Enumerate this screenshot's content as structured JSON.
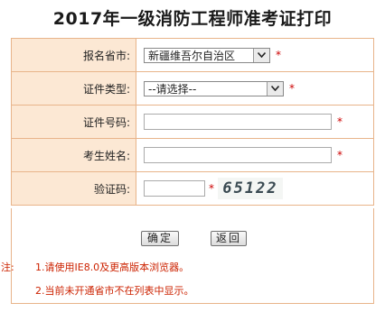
{
  "title": "2017年一级消防工程师准考证打印",
  "form": {
    "province_label": "报名省市:",
    "province_value": "新疆维吾尔自治区",
    "id_type_label": "证件类型:",
    "id_type_value": "--请选择--",
    "id_number_label": "证件号码:",
    "id_number_value": "",
    "name_label": "考生姓名:",
    "name_value": "",
    "captcha_label": "验证码:",
    "captcha_value": "",
    "captcha_text": "65122",
    "required_mark": "*"
  },
  "buttons": {
    "confirm": "确定",
    "back": "返回"
  },
  "notes": {
    "prefix": "注:",
    "line1": "1.请使用IE8.0及更高版本浏览器。",
    "line2": "2.当前未开通省市不在列表中显示。"
  },
  "colors": {
    "label_bg": "#fce8d4",
    "border": "#e8b48a",
    "required": "#cc0000",
    "note_text": "#cc2200"
  }
}
